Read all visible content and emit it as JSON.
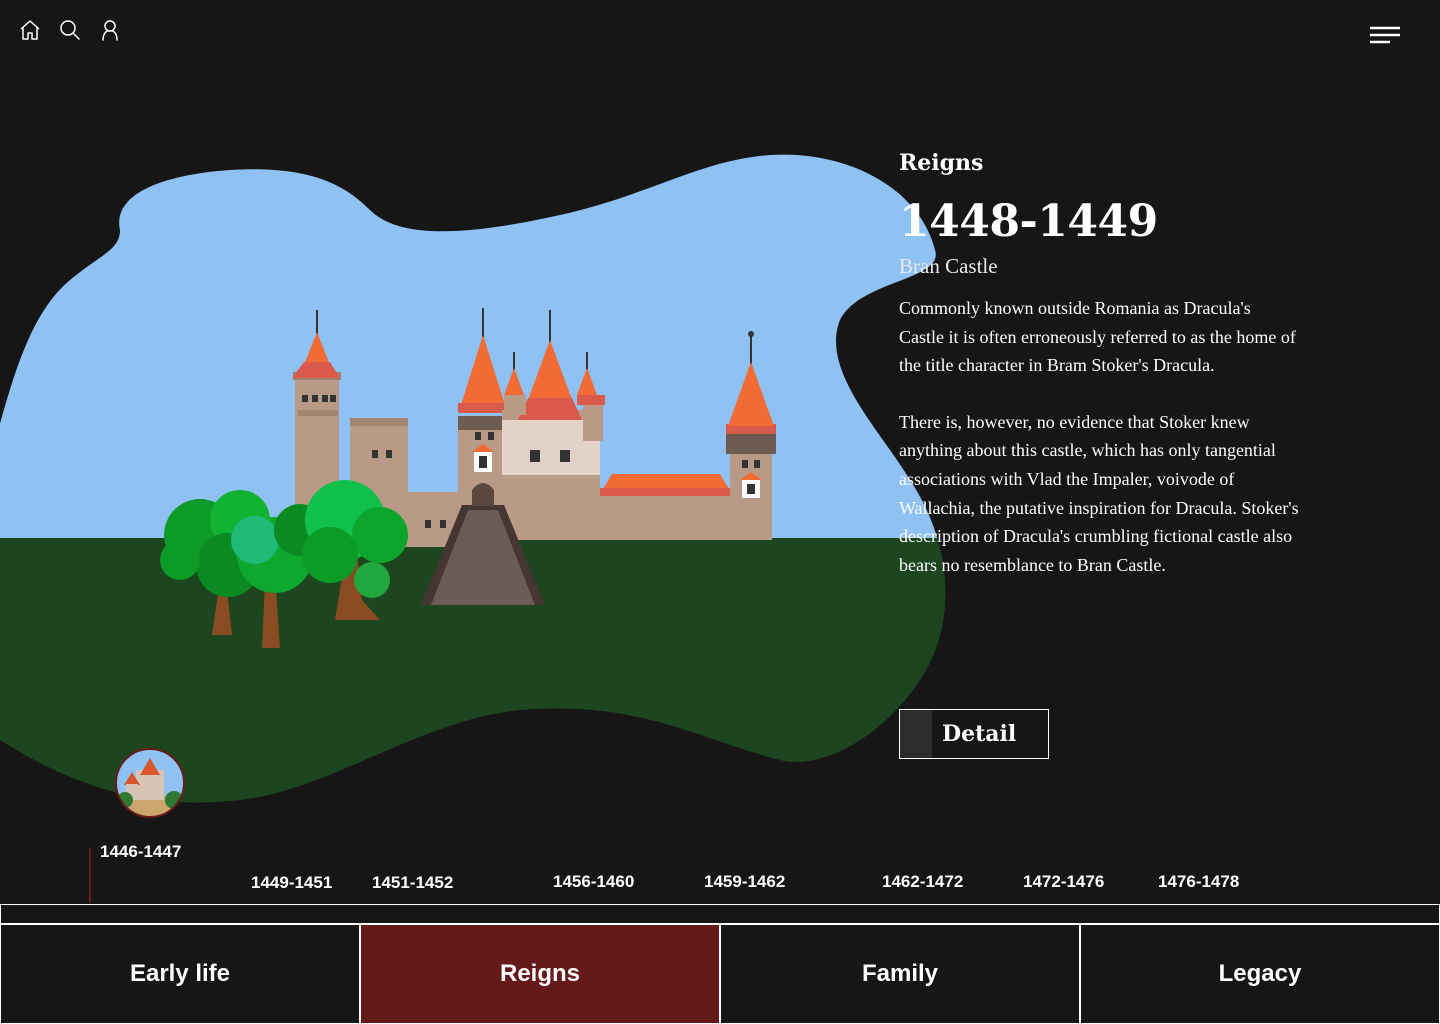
{
  "colors": {
    "background": "#161616",
    "sky": "#8fc1f3",
    "grass": "#1d4620",
    "accent": "#641a1a"
  },
  "nav": {
    "icons": [
      "home-icon",
      "search-icon",
      "user-icon"
    ],
    "menu_icon": "hamburger-menu-icon"
  },
  "info": {
    "section": "Reigns",
    "years": "1448-1449",
    "place": "Bran Castle",
    "paragraph1": "Commonly known outside Romania as Dracula's Castle it is often erroneously referred to as the home of the title character in Bram Stoker's Dracula.",
    "paragraph2": "There is, however, no evidence that Stoker knew anything about this castle, which has only tangential associations with Vlad the Impaler, voivode of Wallachia, the putative inspiration for Dracula. Stoker's description of Dracula's crumbling fictional castle also bears no resemblance to Bran Castle.",
    "detail_label": "Detail"
  },
  "timeline": [
    "1446-1447",
    "1449-1451",
    "1451-1452",
    "1456-1460",
    "1459-1462",
    "1462-1472",
    "1472-1476",
    "1476-1478"
  ],
  "tabs": [
    {
      "label": "Early life",
      "active": false
    },
    {
      "label": "Reigns",
      "active": true
    },
    {
      "label": "Family",
      "active": false
    },
    {
      "label": "Legacy",
      "active": false
    }
  ]
}
